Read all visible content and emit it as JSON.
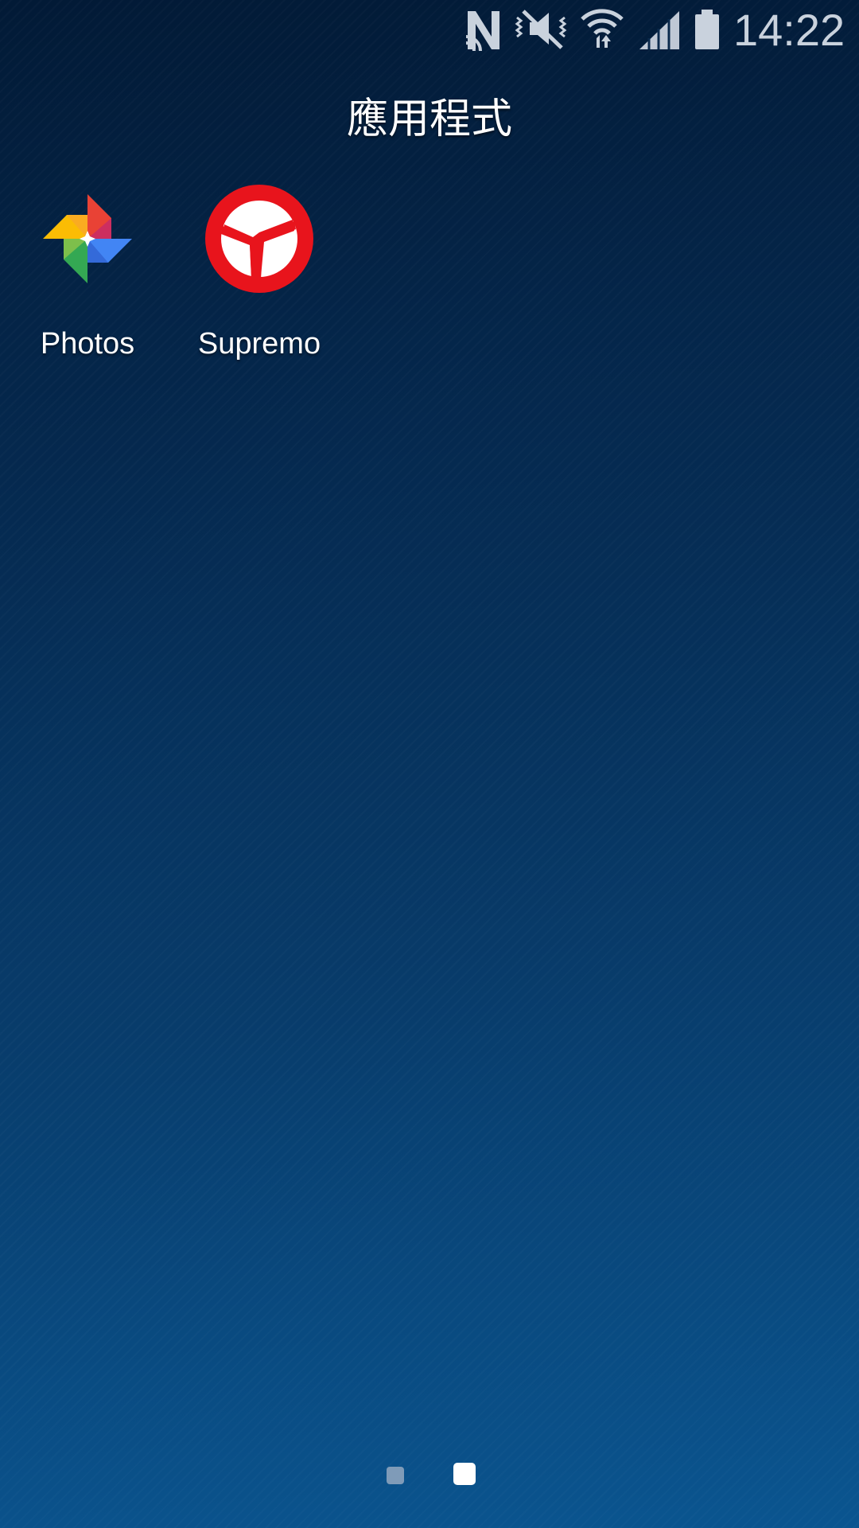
{
  "status_bar": {
    "time": "14:22",
    "icons": [
      "nfc-icon",
      "mute-vibrate-icon",
      "wifi-icon",
      "signal-icon",
      "battery-icon"
    ]
  },
  "folder": {
    "title": "應用程式"
  },
  "apps": [
    {
      "label": "Photos",
      "icon": "google-photos-icon"
    },
    {
      "label": "Supremo",
      "icon": "supremo-icon"
    }
  ],
  "page_indicator": {
    "pages": 2,
    "current": 2
  },
  "colors": {
    "background_top": "#021a36",
    "background_bottom": "#0a5590",
    "supremo_red": "#e8141c",
    "status_icon": "#c9d2dd"
  }
}
